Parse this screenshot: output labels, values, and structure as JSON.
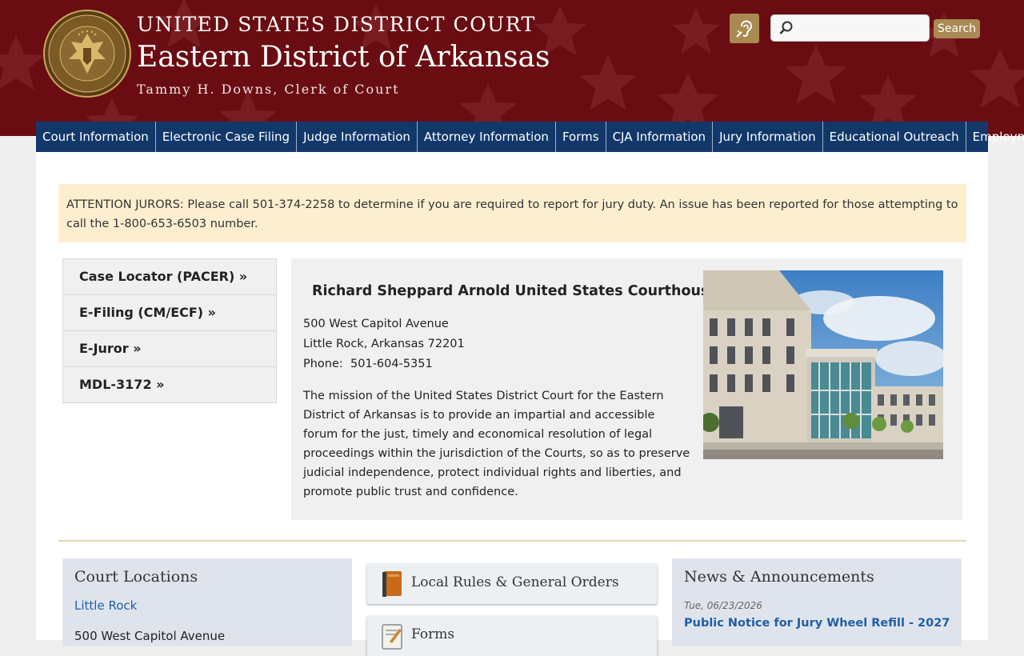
{
  "header": {
    "court_name": "UNITED STATES DISTRICT COURT",
    "district": "Eastern District of Arkansas",
    "clerk": "Tammy H. Downs, Clerk of Court",
    "seal_text": "UNITED STATES DISTRICT COURT EASTERN DISTRICT OF ARKANSAS",
    "search_placeholder": "",
    "search_button": "Search",
    "colors": {
      "banner": "#6a0d12",
      "gold": "#a98a53"
    }
  },
  "nav": {
    "items": [
      "Court Information",
      "Electronic Case Filing",
      "Judge Information",
      "Attorney Information",
      "Forms",
      "CJA Information",
      "Jury Information",
      "Educational Outreach",
      "Employment"
    ],
    "color": "#12386a"
  },
  "alert": {
    "text": "ATTENTION JURORS: Please call 501-374-2258 to determine if you are required to report for jury duty. An issue has been reported for those attempting to call the 1-800-653-6503 number."
  },
  "quick_links": [
    "Case Locator (PACER) »",
    "E-Filing (CM/ECF) »",
    "E-Juror »",
    "MDL-3172 »"
  ],
  "courthouse": {
    "name": "Richard Sheppard Arnold United States Courthouse",
    "address_line1": "500 West Capitol Avenue",
    "address_line2": "Little Rock, Arkansas 72201",
    "phone": "Phone:  501-604-5351",
    "mission": "The mission of the United States District Court for the Eastern District of Arkansas is to provide an impartial and accessible forum for the just, timely and economical resolution of legal proceedings within the jurisdiction of the Courts, so as to preserve judicial independence, protect individual rights and liberties, and promote public trust and confidence."
  },
  "locations": {
    "title": "Court Locations",
    "city": "Little Rock",
    "address": "500 West Capitol Avenue"
  },
  "resources": [
    {
      "label": "Local Rules & General Orders",
      "icon": "book-icon"
    },
    {
      "label": "Forms",
      "icon": "form-icon"
    }
  ],
  "news": {
    "title": "News & Announcements",
    "date": "Tue, 06/23/2026",
    "headline": "Public Notice for Jury Wheel Refill - 2027"
  }
}
